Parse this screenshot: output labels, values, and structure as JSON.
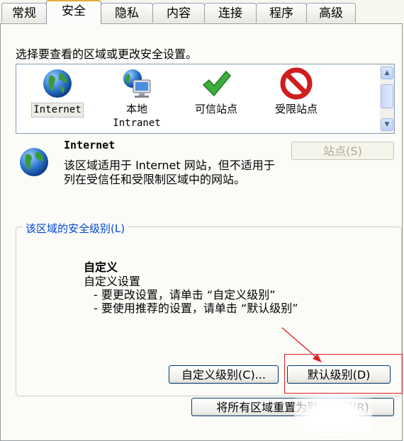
{
  "tabs": [
    "常规",
    "安全",
    "隐私",
    "内容",
    "连接",
    "程序",
    "高级"
  ],
  "prompt": "选择要查看的区域或更改安全设置。",
  "zones": [
    {
      "label": "Internet",
      "label2": "",
      "icon": "globe-icon"
    },
    {
      "label": "本地",
      "label2": "Intranet",
      "icon": "local-intranet-icon"
    },
    {
      "label": "可信站点",
      "label2": "",
      "icon": "checkmark-icon"
    },
    {
      "label": "受限站点",
      "label2": "",
      "icon": "restricted-icon"
    }
  ],
  "selected_zone": {
    "title": "Internet",
    "description": "该区域适用于 Internet 网站，但不适用于列在受信任和受限制区域中的网站。",
    "sites_button": "站点(S)"
  },
  "security_group": {
    "title": "该区域的安全级别(L)",
    "level_name": "自定义",
    "level_lines": [
      "自定义设置",
      "- 要更改设置，请单击 “自定义级别”",
      "- 要使用推荐的设置，请单击 “默认级别”"
    ],
    "custom_button": "自定义级别(C)...",
    "default_button": "默认级别(D)"
  },
  "reset_all_button": "将所有区域重置为默认级别(R)",
  "colors": {
    "annotation": "#d22222",
    "tab_highlight": "#e8a838",
    "group_title": "#0046d5"
  }
}
